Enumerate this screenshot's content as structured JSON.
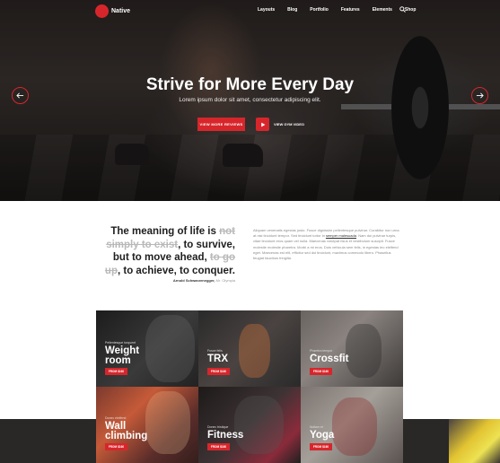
{
  "brand": {
    "name": "Native",
    "accent": "#d7262b"
  },
  "nav": {
    "items": [
      "Layouts",
      "Blog",
      "Portfolio",
      "Features",
      "Elements",
      "Shop"
    ]
  },
  "hero": {
    "title": "Strive for More Every Day",
    "subtitle": "Lorem ipsum dolor sit amet, consectetur adipiscing elit.",
    "primary_button": "VIEW MORE REVIEWS",
    "video_button": "VIEW GYM VIDEO"
  },
  "quote": {
    "t1": "The meaning of life is ",
    "s1": "not simply to exist",
    "t2": ", to survive, but to move ahead, ",
    "s2": "to go up",
    "t3": ", to achieve, to conquer.",
    "author": "Arnold Schwarzenegger,",
    "author_title": "Mr. Olympia"
  },
  "about": {
    "p1": "Aliquam venenatis egestas justo. Fusce dignissim pellentesque pulvinar. Curabitur non urna at nisi tincidunt tempor. Sed tincidunt tortor in ",
    "link": "semper malesuada",
    "p2": ". Nam dui pulvinar turpis, vitae tincidunt eros quam vel nulla. Maecenas volutpat risus et vestibulum suscipit. Fusce molestie molestie pharetra. Morbi a mi eros. Duis vehicula sem felis, in egestas leo eleifend eget. Maecenas est elit, efficitur sed dui tincidunt, maximus commodo libero. Phasellus feugiat faucibus fringilla."
  },
  "classes": [
    {
      "tag": "Pellentesque torquent",
      "name": "Weight room",
      "price": "FROM $160"
    },
    {
      "tag": "Fusce felis",
      "name": "TRX",
      "price": "FROM $160"
    },
    {
      "tag": "Pharetra tempor",
      "name": "Crossfit",
      "price": "FROM $160"
    },
    {
      "tag": "Donec eleifend",
      "name": "Wall climbing",
      "price": "FROM $160"
    },
    {
      "tag": "Donec tristique",
      "name": "Fitness",
      "price": "FROM $160"
    },
    {
      "tag": "Nullam et",
      "name": "Yoga",
      "price": "FROM $160"
    }
  ]
}
